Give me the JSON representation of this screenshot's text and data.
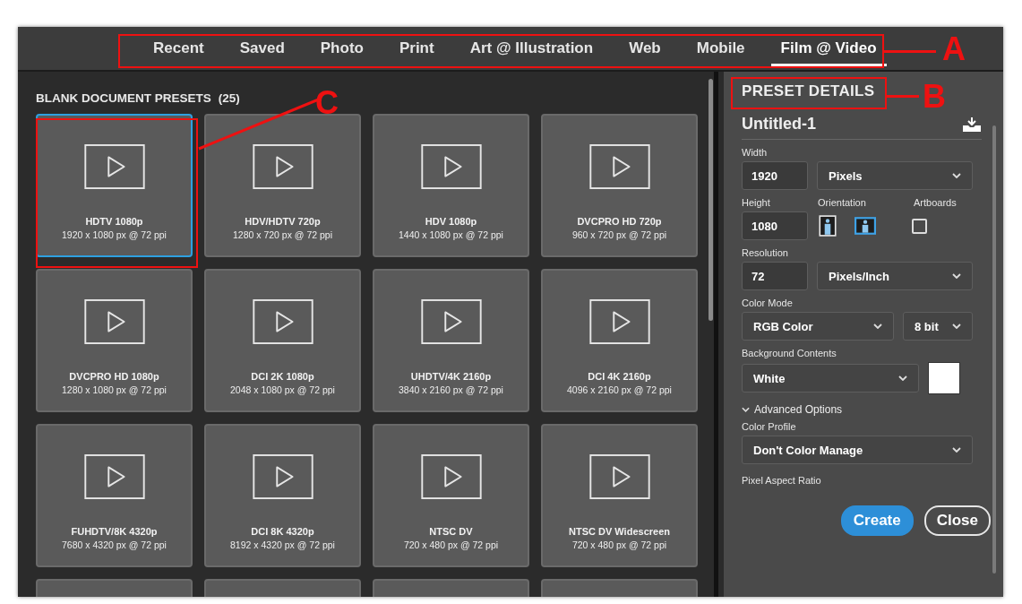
{
  "tabs": [
    {
      "label": "Recent",
      "selected": false
    },
    {
      "label": "Saved",
      "selected": false
    },
    {
      "label": "Photo",
      "selected": false
    },
    {
      "label": "Print",
      "selected": false
    },
    {
      "label": "Art @ Illustration",
      "selected": false
    },
    {
      "label": "Web",
      "selected": false
    },
    {
      "label": "Mobile",
      "selected": false
    },
    {
      "label": "Film @ Video",
      "selected": true
    }
  ],
  "presets_heading": "BLANK DOCUMENT PRESETS",
  "presets_count": "(25)",
  "presets": [
    {
      "kind": "preset",
      "name": "HDTV 1080p",
      "size": "1920 x 1080 px @ 72 ppi",
      "selected": true
    },
    {
      "kind": "preset",
      "name": "HDV/HDTV 720p",
      "size": "1280 x 720 px @ 72 ppi",
      "selected": false
    },
    {
      "kind": "preset",
      "name": "HDV 1080p",
      "size": "1440 x 1080 px @ 72 ppi",
      "selected": false
    },
    {
      "kind": "preset",
      "name": "DVCPRO HD 720p",
      "size": "960 x 720 px @ 72 ppi",
      "selected": false
    },
    {
      "kind": "preset",
      "name": "DVCPRO HD 1080p",
      "size": "1280 x 1080 px @ 72 ppi",
      "selected": false
    },
    {
      "kind": "preset",
      "name": "DCI 2K 1080p",
      "size": "2048 x 1080 px @ 72 ppi",
      "selected": false
    },
    {
      "kind": "preset",
      "name": "UHDTV/4K 2160p",
      "size": "3840 x 2160 px @ 72 ppi",
      "selected": false
    },
    {
      "kind": "preset",
      "name": "DCI 4K 2160p",
      "size": "4096 x 2160 px @ 72 ppi",
      "selected": false
    },
    {
      "kind": "preset",
      "name": "FUHDTV/8K 4320p",
      "size": "7680 x 4320 px @ 72 ppi",
      "selected": false
    },
    {
      "kind": "preset",
      "name": "DCI 8K 4320p",
      "size": "8192 x 4320 px @ 72 ppi",
      "selected": false
    },
    {
      "kind": "preset",
      "name": "NTSC DV",
      "size": "720 x 480 px @ 72 ppi",
      "selected": false
    },
    {
      "kind": "preset",
      "name": "NTSC DV Widescreen",
      "size": "720 x 480 px @ 72 ppi",
      "selected": false
    },
    {
      "kind": "cut-off",
      "selected": false
    },
    {
      "kind": "cut-off",
      "selected": false
    },
    {
      "kind": "cut-off",
      "selected": false
    },
    {
      "kind": "cut-off",
      "selected": false
    }
  ],
  "details": {
    "heading": "PRESET DETAILS",
    "doc_name": "Untitled-1",
    "width_label": "Width",
    "width_value": "1920",
    "width_unit": "Pixels",
    "height_label": "Height",
    "height_value": "1080",
    "orientation_label": "Orientation",
    "orientations": [
      {
        "kind": "portrait",
        "selected": false
      },
      {
        "kind": "landscape",
        "selected": true
      }
    ],
    "artboards_label": "Artboards",
    "artboards_checked": false,
    "resolution_label": "Resolution",
    "resolution_value": "72",
    "resolution_unit": "Pixels/Inch",
    "color_mode_label": "Color Mode",
    "color_mode": "RGB Color",
    "bit_depth": "8 bit",
    "background_label": "Background Contents",
    "background": "White",
    "advanced_label": "Advanced Options",
    "advanced_expanded": true,
    "color_profile_label": "Color Profile",
    "color_profile": "Don't Color Manage",
    "pixel_aspect_label": "Pixel Aspect Ratio"
  },
  "buttons": [
    {
      "kind": "primary",
      "label": "Create"
    },
    {
      "kind": "secondary",
      "label": "Close"
    }
  ],
  "annotations": [
    {
      "label": "A"
    },
    {
      "label": "B"
    },
    {
      "label": "C"
    }
  ]
}
